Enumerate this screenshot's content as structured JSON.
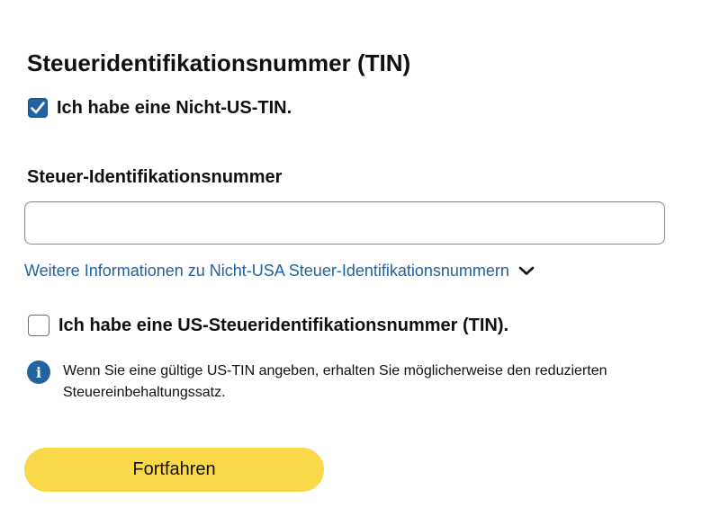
{
  "section": {
    "title": "Steueridentifikationsnummer (TIN)"
  },
  "non_us_tin": {
    "label": "Ich habe eine Nicht-US-TIN.",
    "checked": true
  },
  "tax_id_field": {
    "label": "Steuer-Identifikationsnummer",
    "value": "",
    "placeholder": ""
  },
  "more_info": {
    "text": "Weitere Informationen zu Nicht-USA Steuer-Identifikationsnummern",
    "icon": "chevron-down-icon"
  },
  "us_tin": {
    "label": "Ich habe eine US-Steueridentifikationsnummer (TIN).",
    "checked": false
  },
  "info_notice": {
    "icon": "info-icon",
    "text": "Wenn Sie eine gültige US-TIN angeben, erhalten Sie möglicherweise den reduzierten Steuereinbehaltungssatz."
  },
  "continue_button": {
    "label": "Fortfahren"
  },
  "colors": {
    "accent_blue": "#2162a1",
    "button_yellow": "#f9d849",
    "text": "#0f1111"
  }
}
